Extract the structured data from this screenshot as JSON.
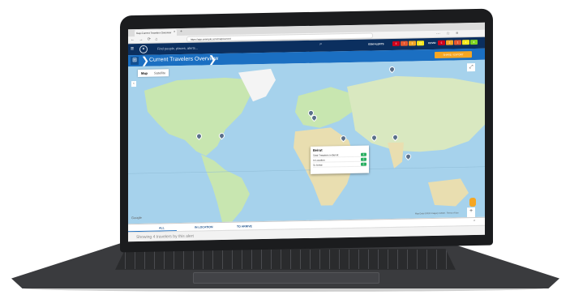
{
  "browser": {
    "tab_title": "Gap-Current Travelers Overview",
    "url": "https://app.example.com/map/current"
  },
  "header": {
    "search_placeholder": "Find people, places, alerts...",
    "alerts_label": "GSM ALERTS",
    "alert_badges": [
      {
        "label": "3",
        "color": "#d0021b"
      },
      {
        "label": "7",
        "color": "#e4572e"
      },
      {
        "label": "9",
        "color": "#f5a623"
      },
      {
        "label": "12",
        "color": "#f8e71c"
      }
    ],
    "covid_label": "COVID",
    "covid_badges": [
      {
        "label": "5",
        "color": "#d0021b"
      },
      {
        "label": "2",
        "color": "#f5a623"
      },
      {
        "label": "1",
        "color": "#e4572e"
      },
      {
        "label": "4",
        "color": "#f8e71c"
      },
      {
        "label": "8",
        "color": "#7ed321"
      }
    ]
  },
  "subheader": {
    "title": "Current Travelers Overview",
    "export_label": "SHARE / EXPORT"
  },
  "map": {
    "toggle": [
      "Map",
      "Satellite"
    ],
    "attribution": "Map Data ©2020 Imagery ©2020 · Terms of Use"
  },
  "popup": {
    "city": "Beirut",
    "rows": [
      {
        "label": "Total Travelers in Beirut",
        "count": "4"
      },
      {
        "label": "In Location",
        "count": "2"
      },
      {
        "label": "To Arrive",
        "count": "2"
      }
    ]
  },
  "bottom_tabs": [
    "ALL",
    "IN LOCATION",
    "TO ARRIVE"
  ],
  "status": "Showing 4 travelers by this alert",
  "colors": {
    "header_navy": "#0b2f5f",
    "subheader_blue": "#1b6fc2",
    "accent_orange": "#f5a623",
    "ocean": "#a6d2ec",
    "land": "#c8e6b0"
  }
}
